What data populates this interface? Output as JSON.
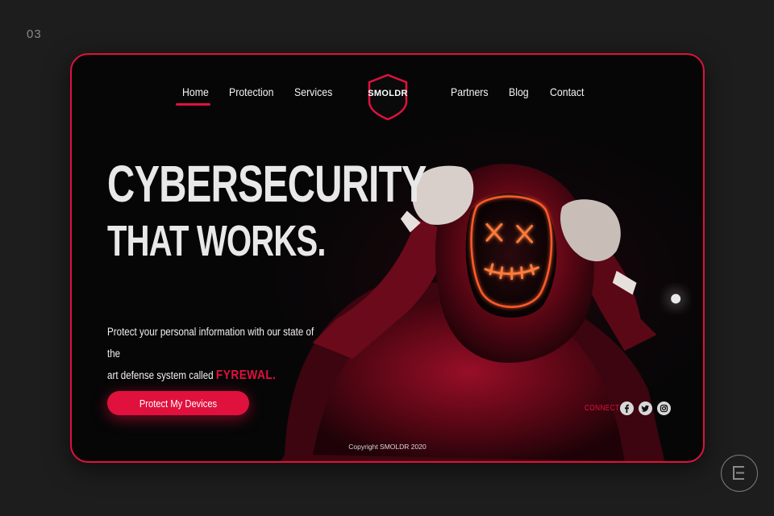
{
  "page_number": "03",
  "nav": {
    "items": [
      {
        "label": "Home",
        "active": true
      },
      {
        "label": "Protection"
      },
      {
        "label": "Services"
      },
      {
        "label": "Partners"
      },
      {
        "label": "Blog"
      },
      {
        "label": "Contact"
      }
    ],
    "logo": "SMOLDR"
  },
  "hero": {
    "headline_1": "CYBERSECURITY",
    "headline_2": "THAT WORKS.",
    "subtext_1": "Protect your personal information with our state of the",
    "subtext_2": "art defense system called",
    "brand": "FYREWAL.",
    "cta_label": "Protect My Devices"
  },
  "footer": {
    "connect_label": "CONNECT",
    "social_icons": [
      "facebook-icon",
      "twitter-icon",
      "instagram-icon"
    ],
    "copyright": "Copyright SMOLDR 2020"
  },
  "colors": {
    "accent": "#e0113d",
    "background": "#1d1d1e",
    "card": "#060607"
  }
}
